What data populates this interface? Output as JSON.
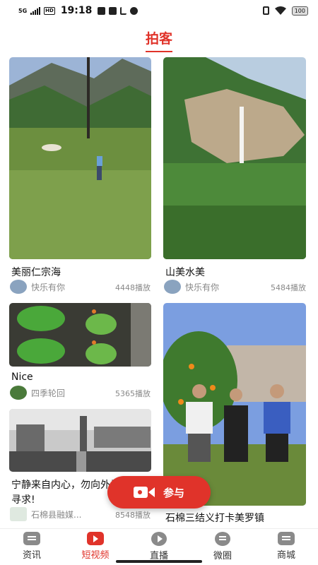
{
  "status": {
    "network": "5G",
    "hd": "HD",
    "time": "19:18",
    "battery": "100"
  },
  "header": {
    "title": "拍客"
  },
  "cards": [
    {
      "title": "美丽仁宗海",
      "author": "快乐有你",
      "plays": "4448播放"
    },
    {
      "title": "山美水美",
      "author": "快乐有你",
      "plays": "5484播放"
    },
    {
      "title": "Nice",
      "author": "四季轮回",
      "plays": "5365播放"
    },
    {
      "title": "宁静来自内心，勿向外寻求!",
      "title_line2": "寻求!",
      "author": "石棉县融媒...",
      "plays": "8548播放"
    },
    {
      "title": "石棉三结义打卡美罗镇",
      "author": "",
      "plays": ""
    }
  ],
  "fab": {
    "label": "参与"
  },
  "tabs": [
    {
      "label": "资讯",
      "icon": "news-icon"
    },
    {
      "label": "短视频",
      "icon": "short-video-icon"
    },
    {
      "label": "直播",
      "icon": "live-icon"
    },
    {
      "label": "微圈",
      "icon": "circle-icon"
    },
    {
      "label": "商城",
      "icon": "mall-icon"
    }
  ],
  "colors": {
    "accent": "#e0332a",
    "muted": "#888888"
  }
}
